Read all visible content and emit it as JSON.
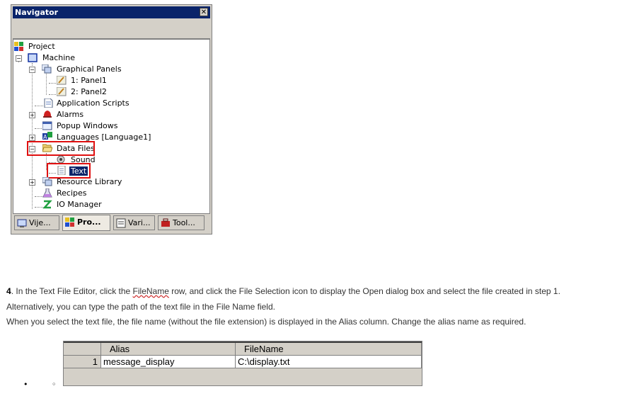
{
  "navigator": {
    "title": "Navigator",
    "close_glyph": "✕",
    "tree": [
      {
        "label": "Project"
      },
      {
        "label": "Machine"
      },
      {
        "label": "Graphical Panels"
      },
      {
        "label": "1: Panel1"
      },
      {
        "label": "2: Panel2"
      },
      {
        "label": "Application Scripts"
      },
      {
        "label": "Alarms"
      },
      {
        "label": "Popup Windows"
      },
      {
        "label": "Languages [Language1]"
      },
      {
        "label": "Data Files"
      },
      {
        "label": "Sound"
      },
      {
        "label": "Text",
        "selected": true
      },
      {
        "label": "Resource Library"
      },
      {
        "label": "Recipes"
      },
      {
        "label": "IO Manager"
      }
    ],
    "tabs": [
      {
        "label": "Vije...",
        "icon": "view-icon"
      },
      {
        "label": "Pro...",
        "icon": "project-icon",
        "active": true
      },
      {
        "label": "Vari...",
        "icon": "variables-icon"
      },
      {
        "label": "Tool...",
        "icon": "toolbox-icon"
      }
    ],
    "highlight_color": "#e01010",
    "title_color": "#0a246a"
  },
  "instructions": {
    "step_number": "4",
    "line1_a": ". In the Text File Editor, click the ",
    "line1_link": "FileName",
    "line1_b": " row, and click the File Selection icon to display the Open dialog box and select the file created in step 1.",
    "line2": "Alternatively, you can type the path of the text file in the File Name field.",
    "line3": "When you select the text file, the file name (without the file extension) is displayed in the Alias column. Change the alias name as required."
  },
  "table": {
    "columns": [
      "Alias",
      "FileName"
    ],
    "rows": [
      {
        "index": "1",
        "alias": "message_display",
        "filename": "C:\\display.txt"
      }
    ]
  },
  "bullets": {
    "filled": "•",
    "hollow": "◦"
  }
}
